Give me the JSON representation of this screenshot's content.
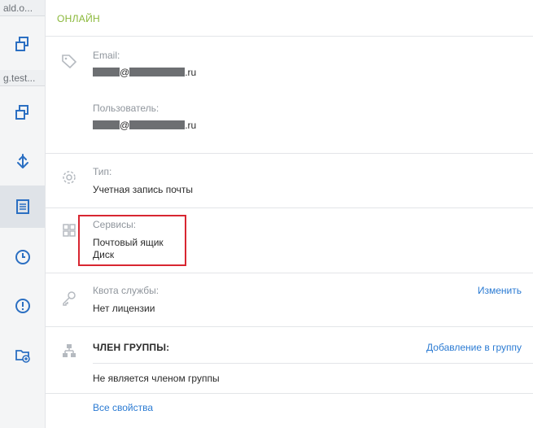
{
  "sidebar": {
    "item1_label": "ald.o...",
    "item2_label": "g.test...",
    "icons": [
      "copy-icon",
      "copy-icon",
      "anchor-icon",
      "document-list-icon",
      "clock-icon",
      "alert-icon",
      "folder-add-icon"
    ]
  },
  "status": "ОНЛАЙН",
  "email": {
    "label": "Email:",
    "at": "@",
    "domain": ".ru"
  },
  "user": {
    "label": "Пользователь:",
    "at": "@",
    "domain": ".ru"
  },
  "type": {
    "label": "Тип:",
    "value": "Учетная запись почты"
  },
  "services": {
    "label": "Сервисы:",
    "items": [
      "Почтовый ящик",
      "Диск"
    ]
  },
  "quota": {
    "label": "Квота службы:",
    "value": "Нет лицензии",
    "action": "Изменить"
  },
  "group": {
    "heading": "ЧЛЕН ГРУППЫ:",
    "action": "Добавление в группу",
    "value": "Не является членом группы"
  },
  "all_properties": "Все свойства",
  "colors": {
    "status": "#8ab83a",
    "link": "#2b7bd3",
    "highlight": "#d82631"
  }
}
